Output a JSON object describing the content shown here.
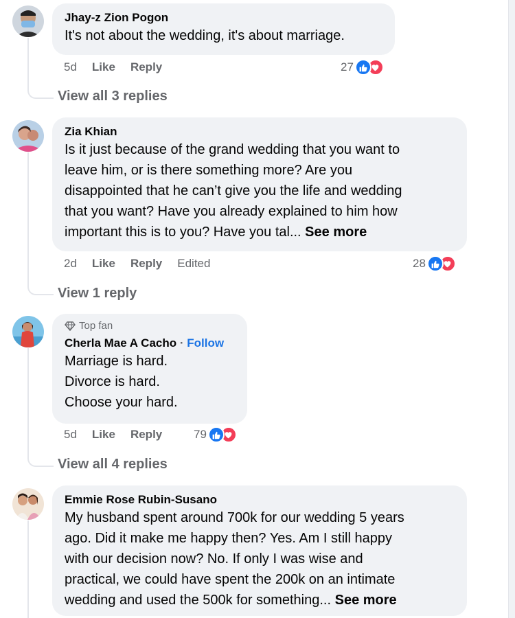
{
  "comments": [
    {
      "author": "Jhay-z Zion Pogon",
      "text": "It's not about the wedding, it's about marriage.",
      "time": "5d",
      "like": "Like",
      "reply": "Reply",
      "reactions": "27",
      "view_replies": "View all 3 replies"
    },
    {
      "author": "Zia Khian",
      "lines": [
        "Is it just because of the grand wedding that you want to",
        "leave him, or is there something more? Are you",
        "disappointed that he can’t give you the life and wedding",
        "that you want? Have you already explained to him how",
        "important this is to you? Have you tal..."
      ],
      "see_more": "See more",
      "time": "2d",
      "like": "Like",
      "reply": "Reply",
      "edited": "Edited",
      "reactions": "28",
      "view_replies": "View 1 reply"
    },
    {
      "badge": "Top fan",
      "author": "Cherla Mae A Cacho",
      "separator": "·",
      "follow": "Follow",
      "lines": [
        "Marriage is hard.",
        "Divorce is hard.",
        "Choose your hard."
      ],
      "time": "5d",
      "like": "Like",
      "reply": "Reply",
      "reactions": "79",
      "view_replies": "View all 4 replies"
    },
    {
      "author": "Emmie Rose Rubin-Susano",
      "lines": [
        "My husband spent around 700k for our wedding 5 years",
        "ago. Did it make me happy then? Yes. Am I still happy",
        "with our decision now? No. If only I was wise and",
        "practical, we could have spent the 200k on an intimate",
        "wedding and used the 500k for something..."
      ],
      "see_more": "See more"
    }
  ],
  "colors": {
    "like": "#1877f2",
    "love": "#f33e58",
    "bubble": "#f0f2f5",
    "meta": "#65676b",
    "link": "#1b74e4"
  }
}
